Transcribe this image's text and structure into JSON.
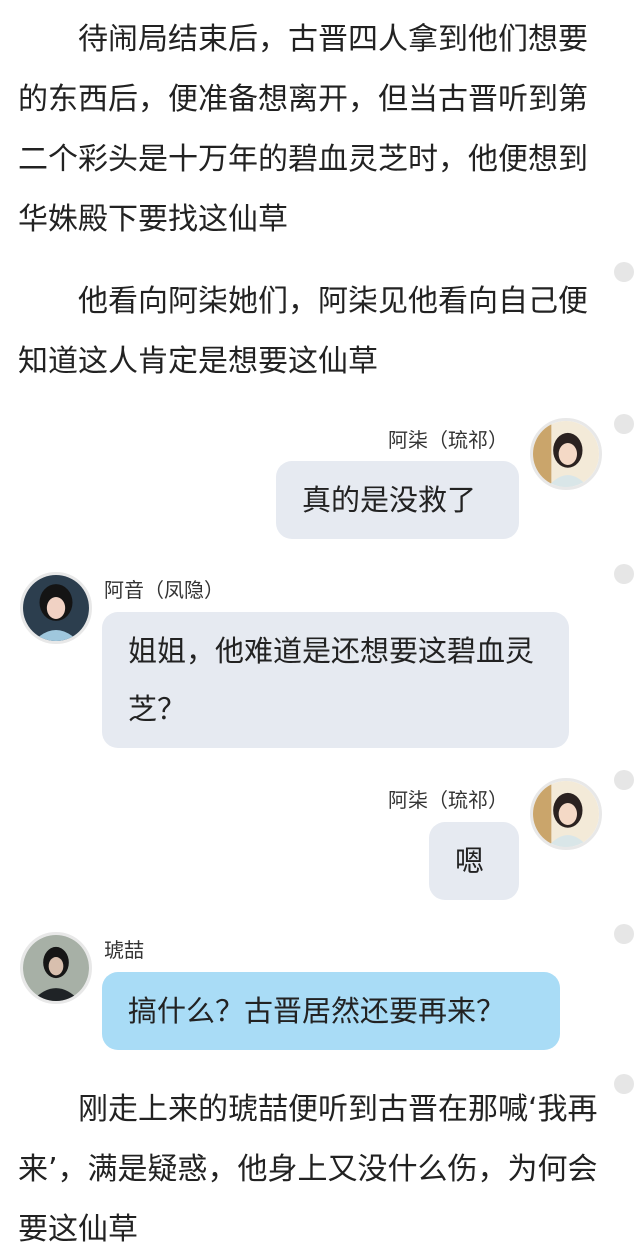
{
  "paragraphs": [
    {
      "text": "待闹局结束后，古晋四人拿到他们想要的东西后，便准备想离开，但当古晋听到第二个彩头是十万年的碧血灵芝时，他便想到华姝殿下要找这仙草"
    },
    {
      "text": "他看向阿柒她们，阿柒见他看向自己便知道这人肯定是想要这仙草"
    },
    {
      "text": "刚走上来的琥喆便听到古晋在那喊‘我再来’，满是疑惑，他身上又没什么伤，为何会要这仙草"
    }
  ],
  "messages": [
    {
      "sender": "阿柒（琉祁）",
      "text": "真的是没救了",
      "side": "right"
    },
    {
      "sender": "阿音（凤隐）",
      "text": "姐姐，他难道是还想要这碧血灵芝？",
      "side": "left"
    },
    {
      "sender": "阿柒（琉祁）",
      "text": "嗯",
      "side": "right"
    },
    {
      "sender": "琥喆",
      "text": "搞什么？古晋居然还要再来？",
      "side": "left"
    }
  ],
  "colors": {
    "bubble_grey": "#e6eaf1",
    "bubble_blue": "#a9dcf6",
    "text": "#222222"
  }
}
